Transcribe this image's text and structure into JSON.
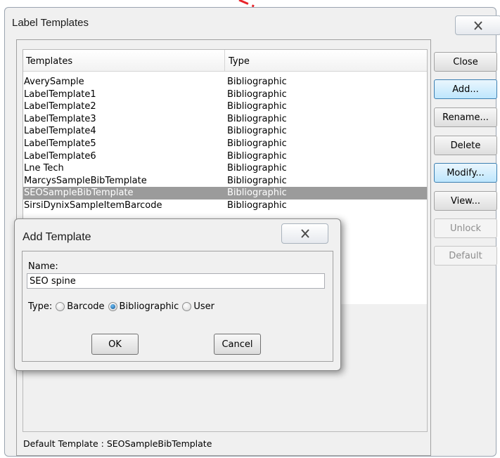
{
  "window": {
    "title": "Label Templates"
  },
  "list": {
    "headers": [
      "Templates",
      "Type"
    ],
    "rows": [
      {
        "name": "AverySample",
        "type": "Bibliographic"
      },
      {
        "name": "LabelTemplate1",
        "type": "Bibliographic"
      },
      {
        "name": "LabelTemplate2",
        "type": "Bibliographic"
      },
      {
        "name": "LabelTemplate3",
        "type": "Bibliographic"
      },
      {
        "name": "LabelTemplate4",
        "type": "Bibliographic"
      },
      {
        "name": "LabelTemplate5",
        "type": "Bibliographic"
      },
      {
        "name": "LabelTemplate6",
        "type": "Bibliographic"
      },
      {
        "name": "Lne Tech",
        "type": "Bibliographic"
      },
      {
        "name": "MarcysSampleBibTemplate",
        "type": "Bibliographic"
      },
      {
        "name": "SEOSampleBibTemplate",
        "type": "Bibliographic",
        "selected": true
      },
      {
        "name": "SirsiDynixSampleItemBarcode",
        "type": "Bibliographic"
      }
    ]
  },
  "status": "Default Template : SEOSampleBibTemplate",
  "buttons": {
    "close": "Close",
    "add": "Add...",
    "rename": "Rename...",
    "delete": "Delete",
    "modify": "Modify...",
    "view": "View...",
    "unlock": "Unlock",
    "default": "Default"
  },
  "dialog": {
    "title": "Add Template",
    "name_label": "Name:",
    "name_value": "SEO spine",
    "type_label": "Type:",
    "options": [
      "Barcode",
      "Bibliographic",
      "User"
    ],
    "selected_option": "Bibliographic",
    "ok": "OK",
    "cancel": "Cancel"
  },
  "colors": {
    "selection": "#9b9b9b",
    "annotation_arrow": "#e8242a"
  }
}
